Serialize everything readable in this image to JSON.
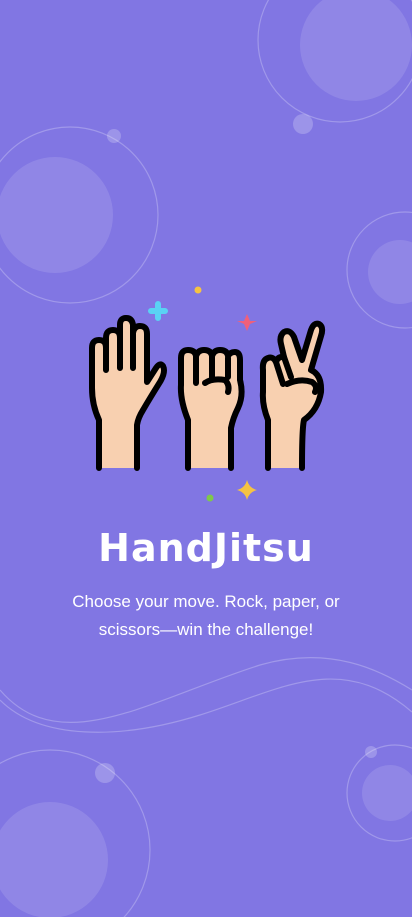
{
  "app": {
    "title": "HandJitsu",
    "tagline": "Choose your move. Rock, paper, or scissors—win the challenge!"
  },
  "colors": {
    "background": "#8176e3",
    "skin": "#f8d0b0",
    "outline": "#000000",
    "accent_blue": "#5ad2f4",
    "accent_pink": "#f0607a",
    "accent_yellow": "#f6c343",
    "accent_green": "#7ec84a"
  },
  "icons": [
    "paper-hand-icon",
    "rock-fist-icon",
    "scissors-hand-icon",
    "sparkle-icon"
  ]
}
